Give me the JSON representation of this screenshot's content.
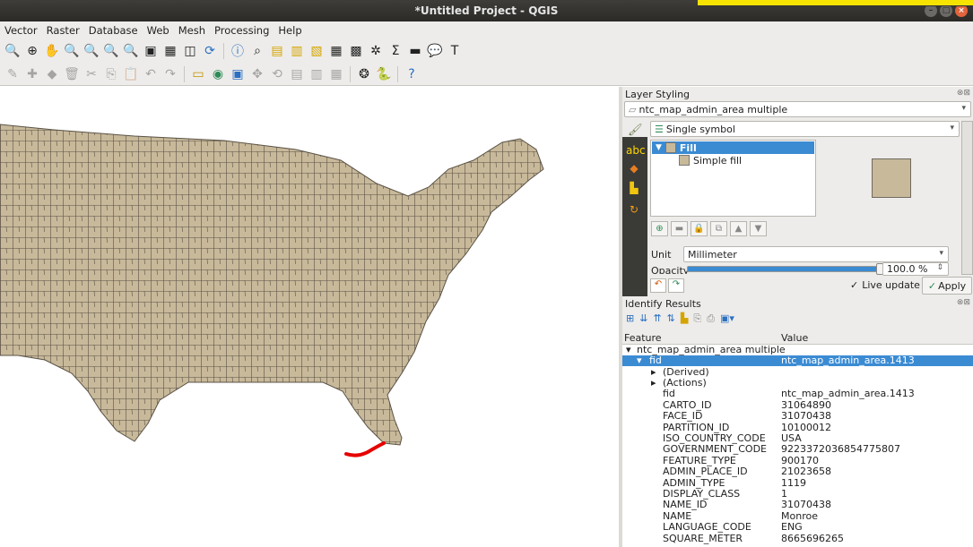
{
  "window": {
    "title": "*Untitled Project - QGIS"
  },
  "menu": [
    "Vector",
    "Raster",
    "Database",
    "Web",
    "Mesh",
    "Processing",
    "Help"
  ],
  "toolbar1": {
    "icons": [
      "zoom-out-icon",
      "zoom-full-icon",
      "pan-icon",
      "zoom-layer-icon",
      "zoom-selection-icon",
      "zoom-last-icon",
      "zoom-next-icon",
      "new-map-view-icon",
      "new-3d-view-icon",
      "refresh-icon",
      "identify-icon",
      "identify-dropdown-icon",
      "select-icon",
      "deselect-icon",
      "open-table-icon",
      "statistics-icon",
      "field-calc-icon",
      "sum-icon",
      "measure-icon",
      "map-tips-icon",
      "text-annotation-icon"
    ]
  },
  "toolbar2": {
    "icons": [
      "digitize-icon",
      "add-feature-icon",
      "vertex-tool-icon",
      "delete-icon",
      "cut-icon",
      "copy-icon",
      "paste-icon",
      "undo-icon",
      "redo-icon",
      "label-icon",
      "pin-label-icon",
      "show-label-icon",
      "move-label-icon",
      "rotate-label-icon",
      "change-label-icon",
      "diagram-icon",
      "python-icon",
      "help-icon"
    ]
  },
  "layer_styling": {
    "title": "Layer Styling",
    "layer": "ntc_map_admin_area multiple",
    "renderer": "Single symbol",
    "tree": {
      "fill": "Fill",
      "simple_fill": "Simple fill"
    },
    "unit_label": "Unit",
    "unit_value": "Millimeter",
    "opacity_label": "Opacity",
    "opacity_value": "100.0 %",
    "opacity_fraction": 1.0,
    "live_update": "Live update",
    "apply": "Apply",
    "fill_color": "#c8b99a"
  },
  "identify": {
    "title": "Identify Results",
    "col_feature": "Feature",
    "col_value": "Value",
    "layer_row": "ntc_map_admin_area multiple",
    "fid_row": {
      "key": "fid",
      "value": "ntc_map_admin_area.1413"
    },
    "derived": "(Derived)",
    "actions": "(Actions)",
    "attributes": [
      {
        "key": "fid",
        "value": "ntc_map_admin_area.1413"
      },
      {
        "key": "CARTO_ID",
        "value": "31064890"
      },
      {
        "key": "FACE_ID",
        "value": "31070438"
      },
      {
        "key": "PARTITION_ID",
        "value": "10100012"
      },
      {
        "key": "ISO_COUNTRY_CODE",
        "value": "USA"
      },
      {
        "key": "GOVERNMENT_CODE",
        "value": "9223372036854775807"
      },
      {
        "key": "FEATURE_TYPE",
        "value": "900170"
      },
      {
        "key": "ADMIN_PLACE_ID",
        "value": "21023658"
      },
      {
        "key": "ADMIN_TYPE",
        "value": "1119"
      },
      {
        "key": "DISPLAY_CLASS",
        "value": "1"
      },
      {
        "key": "NAME_ID",
        "value": "31070438"
      },
      {
        "key": "NAME",
        "value": "Monroe"
      },
      {
        "key": "LANGUAGE_CODE",
        "value": "ENG"
      },
      {
        "key": "SQUARE_METER",
        "value": "8665696265"
      }
    ]
  },
  "map": {
    "fill_color": "#c8b99a",
    "stroke_color": "#5a5246",
    "highlight_color": "#e60000"
  }
}
